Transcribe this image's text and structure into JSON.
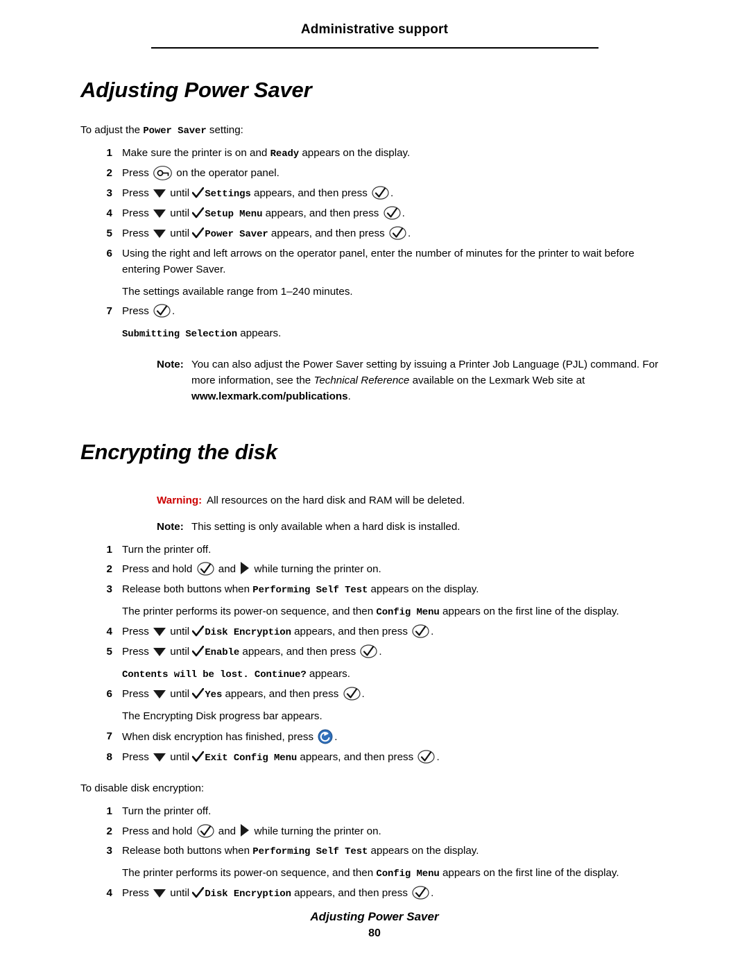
{
  "header": {
    "title": "Administrative support"
  },
  "section1": {
    "title": "Adjusting Power Saver",
    "intro_pre": "To adjust the ",
    "intro_mono": "Power Saver",
    "intro_post": " setting:",
    "steps": [
      {
        "num": "1",
        "parts": [
          {
            "t": "text",
            "v": "Make sure the printer is on and "
          },
          {
            "t": "mono",
            "v": "Ready"
          },
          {
            "t": "text",
            "v": " appears on the display."
          }
        ]
      },
      {
        "num": "2",
        "parts": [
          {
            "t": "text",
            "v": "Press "
          },
          {
            "t": "icon",
            "v": "menu-key-icon"
          },
          {
            "t": "text",
            "v": " on the operator panel."
          }
        ]
      },
      {
        "num": "3",
        "parts": [
          {
            "t": "text",
            "v": "Press "
          },
          {
            "t": "icon",
            "v": "down-arrow-icon"
          },
          {
            "t": "text",
            "v": " until "
          },
          {
            "t": "icon",
            "v": "check-icon"
          },
          {
            "t": "mono",
            "v": "Settings"
          },
          {
            "t": "text",
            "v": " appears, and then press "
          },
          {
            "t": "icon",
            "v": "select-icon"
          },
          {
            "t": "text",
            "v": "."
          }
        ]
      },
      {
        "num": "4",
        "parts": [
          {
            "t": "text",
            "v": "Press "
          },
          {
            "t": "icon",
            "v": "down-arrow-icon"
          },
          {
            "t": "text",
            "v": " until "
          },
          {
            "t": "icon",
            "v": "check-icon"
          },
          {
            "t": "mono",
            "v": "Setup Menu"
          },
          {
            "t": "text",
            "v": " appears, and then press "
          },
          {
            "t": "icon",
            "v": "select-icon"
          },
          {
            "t": "text",
            "v": "."
          }
        ]
      },
      {
        "num": "5",
        "parts": [
          {
            "t": "text",
            "v": "Press "
          },
          {
            "t": "icon",
            "v": "down-arrow-icon"
          },
          {
            "t": "text",
            "v": " until "
          },
          {
            "t": "icon",
            "v": "check-icon"
          },
          {
            "t": "mono",
            "v": "Power Saver"
          },
          {
            "t": "text",
            "v": " appears, and then press "
          },
          {
            "t": "icon",
            "v": "select-icon"
          },
          {
            "t": "text",
            "v": "."
          }
        ]
      },
      {
        "num": "6",
        "parts": [
          {
            "t": "text",
            "v": "Using the right and left arrows on the operator panel, enter the number of minutes for the printer to wait before entering Power Saver."
          }
        ]
      },
      {
        "num": "",
        "sub": true,
        "parts": [
          {
            "t": "text",
            "v": "The settings available range from 1–240 minutes."
          }
        ]
      },
      {
        "num": "7",
        "parts": [
          {
            "t": "text",
            "v": "Press "
          },
          {
            "t": "icon",
            "v": "select-icon"
          },
          {
            "t": "text",
            "v": "."
          }
        ]
      },
      {
        "num": "",
        "sub": true,
        "parts": [
          {
            "t": "mono",
            "v": "Submitting Selection"
          },
          {
            "t": "text",
            "v": " appears."
          }
        ]
      }
    ],
    "note": {
      "label": "Note:",
      "pre": "You can also adjust the Power Saver setting by issuing a Printer Job Language (PJL) command. For more information, see the ",
      "italic": "Technical Reference",
      "mid": " available on the Lexmark Web site at ",
      "bold_url": "www.lexmark.com/publications",
      "post": "."
    }
  },
  "section2": {
    "title": "Encrypting the disk",
    "warning": {
      "label": "Warning:",
      "text": "All resources on the hard disk and RAM will be deleted."
    },
    "note": {
      "label": "Note:",
      "text": "This setting is only available when a hard disk is installed."
    },
    "steps": [
      {
        "num": "1",
        "parts": [
          {
            "t": "text",
            "v": "Turn the printer off."
          }
        ]
      },
      {
        "num": "2",
        "parts": [
          {
            "t": "text",
            "v": "Press and hold "
          },
          {
            "t": "icon",
            "v": "select-icon"
          },
          {
            "t": "text",
            "v": " and "
          },
          {
            "t": "icon",
            "v": "right-arrow-icon"
          },
          {
            "t": "text",
            "v": " while turning the printer on."
          }
        ]
      },
      {
        "num": "3",
        "parts": [
          {
            "t": "text",
            "v": "Release both buttons when "
          },
          {
            "t": "mono",
            "v": "Performing Self Test"
          },
          {
            "t": "text",
            "v": " appears on the display."
          }
        ]
      },
      {
        "num": "",
        "sub": true,
        "parts": [
          {
            "t": "text",
            "v": "The printer performs its power-on sequence, and then "
          },
          {
            "t": "mono",
            "v": "Config Menu"
          },
          {
            "t": "text",
            "v": " appears on the first line of the display."
          }
        ]
      },
      {
        "num": "4",
        "parts": [
          {
            "t": "text",
            "v": "Press "
          },
          {
            "t": "icon",
            "v": "down-arrow-icon"
          },
          {
            "t": "text",
            "v": " until "
          },
          {
            "t": "icon",
            "v": "check-icon"
          },
          {
            "t": "mono",
            "v": "Disk Encryption"
          },
          {
            "t": "text",
            "v": " appears, and then press "
          },
          {
            "t": "icon",
            "v": "select-icon"
          },
          {
            "t": "text",
            "v": "."
          }
        ]
      },
      {
        "num": "5",
        "parts": [
          {
            "t": "text",
            "v": "Press "
          },
          {
            "t": "icon",
            "v": "down-arrow-icon"
          },
          {
            "t": "text",
            "v": " until "
          },
          {
            "t": "icon",
            "v": "check-icon"
          },
          {
            "t": "mono",
            "v": "Enable"
          },
          {
            "t": "text",
            "v": " appears, and then press "
          },
          {
            "t": "icon",
            "v": "select-icon"
          },
          {
            "t": "text",
            "v": "."
          }
        ]
      },
      {
        "num": "",
        "sub": true,
        "parts": [
          {
            "t": "mono",
            "v": "Contents will be lost. Continue?"
          },
          {
            "t": "text",
            "v": " appears."
          }
        ]
      },
      {
        "num": "6",
        "parts": [
          {
            "t": "text",
            "v": "Press "
          },
          {
            "t": "icon",
            "v": "down-arrow-icon"
          },
          {
            "t": "text",
            "v": " until "
          },
          {
            "t": "icon",
            "v": "check-icon"
          },
          {
            "t": "mono",
            "v": "Yes"
          },
          {
            "t": "text",
            "v": " appears, and then press "
          },
          {
            "t": "icon",
            "v": "select-icon"
          },
          {
            "t": "text",
            "v": "."
          }
        ]
      },
      {
        "num": "",
        "sub": true,
        "parts": [
          {
            "t": "text",
            "v": "The Encrypting Disk progress bar appears."
          }
        ]
      },
      {
        "num": "7",
        "parts": [
          {
            "t": "text",
            "v": "When disk encryption has finished, press "
          },
          {
            "t": "icon",
            "v": "back-icon"
          },
          {
            "t": "text",
            "v": "."
          }
        ]
      },
      {
        "num": "8",
        "parts": [
          {
            "t": "text",
            "v": "Press "
          },
          {
            "t": "icon",
            "v": "down-arrow-icon"
          },
          {
            "t": "text",
            "v": " until "
          },
          {
            "t": "icon",
            "v": "check-icon"
          },
          {
            "t": "mono",
            "v": "Exit Config Menu"
          },
          {
            "t": "text",
            "v": " appears, and then press "
          },
          {
            "t": "icon",
            "v": "select-icon"
          },
          {
            "t": "text",
            "v": "."
          }
        ]
      }
    ],
    "disable_lead": "To disable disk encryption:",
    "disable_steps": [
      {
        "num": "1",
        "parts": [
          {
            "t": "text",
            "v": "Turn the printer off."
          }
        ]
      },
      {
        "num": "2",
        "parts": [
          {
            "t": "text",
            "v": "Press and hold "
          },
          {
            "t": "icon",
            "v": "select-icon"
          },
          {
            "t": "text",
            "v": " and "
          },
          {
            "t": "icon",
            "v": "right-arrow-icon"
          },
          {
            "t": "text",
            "v": " while turning the printer on."
          }
        ]
      },
      {
        "num": "3",
        "parts": [
          {
            "t": "text",
            "v": "Release both buttons when "
          },
          {
            "t": "mono",
            "v": "Performing Self Test"
          },
          {
            "t": "text",
            "v": " appears on the display."
          }
        ]
      },
      {
        "num": "",
        "sub": true,
        "parts": [
          {
            "t": "text",
            "v": "The printer performs its power-on sequence, and then "
          },
          {
            "t": "mono",
            "v": "Config Menu"
          },
          {
            "t": "text",
            "v": " appears on the first line of the display."
          }
        ]
      },
      {
        "num": "4",
        "parts": [
          {
            "t": "text",
            "v": "Press "
          },
          {
            "t": "icon",
            "v": "down-arrow-icon"
          },
          {
            "t": "text",
            "v": " until "
          },
          {
            "t": "icon",
            "v": "check-icon"
          },
          {
            "t": "mono",
            "v": "Disk Encryption"
          },
          {
            "t": "text",
            "v": " appears, and then press "
          },
          {
            "t": "icon",
            "v": "select-icon"
          },
          {
            "t": "text",
            "v": "."
          }
        ]
      }
    ]
  },
  "footer": {
    "name": "Adjusting Power Saver",
    "page": "80"
  },
  "colors": {
    "warning": "#cc0000",
    "back_icon": "#2f6fba",
    "text": "#000000"
  }
}
